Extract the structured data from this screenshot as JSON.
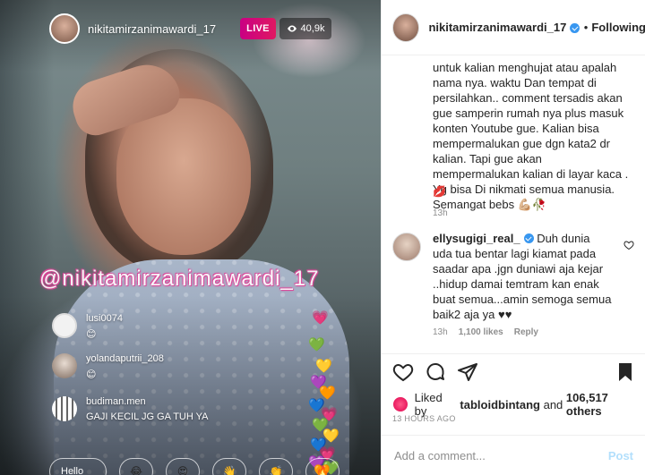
{
  "live": {
    "username": "nikitamirzanimawardi_17",
    "live_label": "LIVE",
    "viewer_count": "40,9k",
    "watermark": "@nikitamirzanimawardi_17",
    "comments": [
      {
        "username": "lusi0074",
        "text": "😊"
      },
      {
        "username": "yolandaputrii_208",
        "text": "😊"
      },
      {
        "username": "budiman.men",
        "text": "GAJI KECIL JG GA TUH YA"
      }
    ],
    "footer": {
      "comment_pill": "Hello",
      "emojis": [
        "😂",
        "😍",
        "👋",
        "👏",
        "🔥"
      ]
    },
    "hearts": [
      "💗",
      "💚",
      "💛",
      "💜",
      "🧡",
      "💙",
      "💗",
      "💚",
      "💛",
      "💙",
      "💗",
      "💜",
      "💚",
      "🧡"
    ]
  },
  "post": {
    "header": {
      "username": "nikitamirzanimawardi_17",
      "separator": "•",
      "following_label": "Following"
    },
    "caption": {
      "text": "untuk kalian menghujat atau apalah nama nya. waktu Dan tempat di persilahkan.. comment tersadis akan gue samperin rumah nya plus masuk konten Youtube gue. Kalian bisa mempermalukan gue dgn kata2 dr kalian. Tapi gue akan mempermalukan kalian di layar kaca . Yg bisa Di nikmati semua manusia. Semangat bebs 💪🏼🥀",
      "extra_emoji": "💋",
      "time": "13h"
    },
    "comment": {
      "username": "ellysugigi_real_",
      "text": "Duh dunia uda tua bentar lagi kiamat pada saadar apa .jgn duniawi aja kejar ..hidup damai temtram kan enak buat semua...amin semoga semua baik2 aja ya ♥♥",
      "time": "13h",
      "likes": "1,100 likes",
      "reply_label": "Reply"
    },
    "likes": {
      "prefix": "Liked by",
      "user": "tabloidbintang",
      "middle": "and",
      "count": "106,517 others"
    },
    "time": "13 HOURS AGO",
    "add_comment": {
      "placeholder": "Add a comment...",
      "post_label": "Post"
    }
  }
}
